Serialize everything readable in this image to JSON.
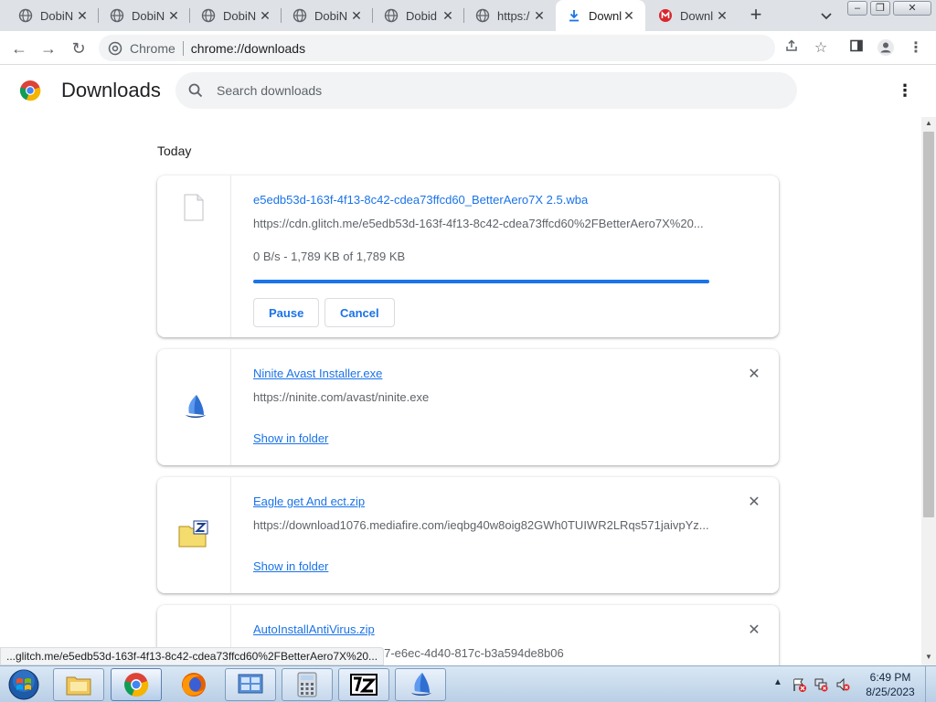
{
  "browser": {
    "tabs": [
      {
        "title": "DobiN",
        "icon": "globe-icon",
        "active": false
      },
      {
        "title": "DobiN",
        "icon": "globe-icon",
        "active": false
      },
      {
        "title": "DobiN",
        "icon": "globe-icon",
        "active": false
      },
      {
        "title": "DobiN",
        "icon": "globe-icon",
        "active": false
      },
      {
        "title": "Dobid",
        "icon": "globe-icon",
        "active": false
      },
      {
        "title": "https:/",
        "icon": "globe-icon",
        "active": false
      },
      {
        "title": "Downl",
        "icon": "download-icon",
        "active": true
      },
      {
        "title": "Downl",
        "icon": "mega-icon",
        "active": false
      }
    ],
    "omnibox": {
      "site_label": "Chrome",
      "url": "chrome://downloads"
    }
  },
  "page": {
    "title": "Downloads",
    "search_placeholder": "Search downloads",
    "date_heading": "Today"
  },
  "downloads": [
    {
      "filename": "e5edb53d-163f-4f13-8c42-cdea73ffcd60_BetterAero7X 2.5.wba",
      "url": "https://cdn.glitch.me/e5edb53d-163f-4f13-8c42-cdea73ffcd60%2FBetterAero7X%20...",
      "status": "0 B/s - 1,789 KB of 1,789 KB",
      "progress": 1.0,
      "pause_label": "Pause",
      "cancel_label": "Cancel",
      "icon": "blank-file-icon"
    },
    {
      "filename": "Ninite Avast Installer.exe",
      "url": "https://ninite.com/avast/ninite.exe",
      "link_label": "Show in folder",
      "icon": "ninite-icon"
    },
    {
      "filename": "Eagle get And ect.zip",
      "url": "https://download1076.mediafire.com/ieqbg40w8oig82GWh0TUIWR2LRqs571jaivpYz...",
      "link_label": "Show in folder",
      "icon": "zip-archive-icon"
    },
    {
      "filename": "AutoInstallAntiVirus.zip",
      "url": "https://mega.nz/79a446d7-e6ec-4d40-817c-b3a594de8b06",
      "icon": "file-icon"
    }
  ],
  "status_bubble": "...glitch.me/e5edb53d-163f-4f13-8c42-cdea73ffcd60%2FBetterAero7X%20...",
  "taskbar": {
    "time": "6:49 PM",
    "date": "8/25/2023"
  },
  "colors": {
    "accent": "#1a73e8",
    "tabstrip": "#dee1e6",
    "secondary_text": "#5f6368"
  }
}
